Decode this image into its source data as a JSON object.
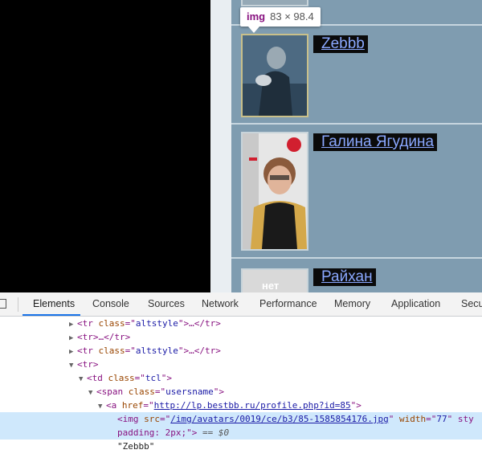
{
  "tooltip": {
    "tag": "img",
    "dims": "83 × 98.4"
  },
  "users": [
    {
      "name": "Zebbb"
    },
    {
      "name": "Галина Ягудина"
    },
    {
      "name": "Райхан",
      "avatar_text": "нет"
    }
  ],
  "devtools": {
    "tabs": [
      "Elements",
      "Console",
      "Sources",
      "Network",
      "Performance",
      "Memory",
      "Application",
      "Secu"
    ],
    "active_tab": "Elements",
    "dom": {
      "line1": {
        "tag_open": "<tr ",
        "attr": "class",
        "eq": "=\"",
        "val": "altstyle",
        "tail": "\">…</tr>"
      },
      "line2": {
        "text": "<tr>…</tr>"
      },
      "line3": {
        "tag_open": "<tr ",
        "attr": "class",
        "eq": "=\"",
        "val": "altstyle",
        "tail": "\">…</tr>"
      },
      "line4": {
        "text": "<tr>"
      },
      "line5": {
        "tag_open": "<td ",
        "attr": "class",
        "eq": "=\"",
        "val": "tcl",
        "tail": "\">"
      },
      "line6": {
        "tag_open": "<span ",
        "attr": "class",
        "eq": "=\"",
        "val": "usersname",
        "tail": "\">"
      },
      "line7": {
        "tag_open": "<a ",
        "attr": "href",
        "eq": "=\"",
        "val": "http://lp.bestbb.ru/profile.php?id=85",
        "tail": "\">"
      },
      "line8": {
        "tag_open": "<img ",
        "attr": "src",
        "eq": "=\"",
        "val": "/img/avatars/0019/ce/b3/85-1585854176.jpg",
        "mid": "\" ",
        "attr2": "width",
        "eq2": "=\"",
        "val2": "77",
        "tail": "\" sty"
      },
      "line9": {
        "text": "padding: 2px;\">",
        "marker": " == $0"
      },
      "line10": {
        "text": "\"Zebbb\""
      }
    }
  }
}
